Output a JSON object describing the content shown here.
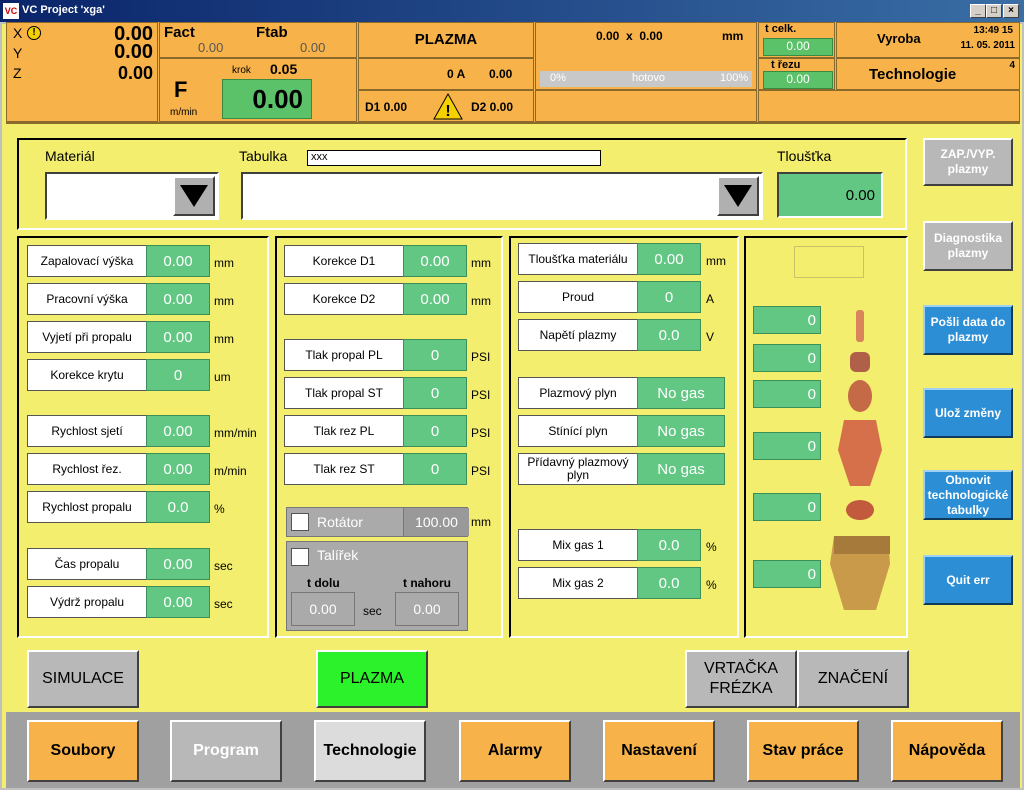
{
  "window": {
    "title": "VC Project 'xga'",
    "logo": "VC"
  },
  "header": {
    "x_label": "X",
    "y_label": "Y",
    "z_label": "Z",
    "x": "0.00",
    "y": "0.00",
    "z": "0.00",
    "fact_label": "Fact",
    "fact": "0.00",
    "ftab_label": "Ftab",
    "ftab": "0.00",
    "f_label": "F",
    "f_unit": "m/min",
    "krok_label": "krok",
    "krok": "0.05",
    "f_value": "0.00",
    "mode": "PLAZMA",
    "current": "0 A",
    "voltage": "0.00",
    "d1": "D1 0.00",
    "d2": "D2 0.00",
    "coords": "0.00  x  0.00",
    "coords_unit": "mm",
    "progress_start": "0%",
    "progress_label": "hotovo",
    "progress_end": "100%",
    "progress": 0,
    "t_celk_label": "t celk.",
    "t_celk": "0.00",
    "t_rezu_label": "t řezu",
    "t_rezu": "0.00",
    "vyroba": "Vyroba",
    "time": "13:49 15",
    "date": "11. 05. 2011",
    "technologie": "Technologie",
    "tech_num": "4"
  },
  "top": {
    "material_label": "Materiál",
    "material_value": "",
    "tabulka_label": "Tabulka",
    "tabulka_value": "xxx",
    "tabulka_select": "",
    "tloustka_label": "Tloušťka",
    "tloustka": "0.00"
  },
  "col1": [
    {
      "label": "Zapalovací výška",
      "value": "0.00",
      "unit": "mm"
    },
    {
      "label": "Pracovní výška",
      "value": "0.00",
      "unit": "mm"
    },
    {
      "label": "Vyjetí při propalu",
      "value": "0.00",
      "unit": "mm"
    },
    {
      "label": "Korekce krytu",
      "value": "0",
      "unit": "um"
    },
    {
      "label": "Rychlost sjetí",
      "value": "0.00",
      "unit": "mm/min"
    },
    {
      "label": "Rychlost řez.",
      "value": "0.00",
      "unit": "m/min"
    },
    {
      "label": "Rychlost propalu",
      "value": "0.0",
      "unit": "%"
    },
    {
      "label": "Čas propalu",
      "value": "0.00",
      "unit": "sec"
    },
    {
      "label": "Výdrž propalu",
      "value": "0.00",
      "unit": "sec"
    }
  ],
  "col2": [
    {
      "label": "Korekce D1",
      "value": "0.00",
      "unit": "mm"
    },
    {
      "label": "Korekce D2",
      "value": "0.00",
      "unit": "mm"
    },
    {
      "label": "Tlak propal PL",
      "value": "0",
      "unit": "PSI"
    },
    {
      "label": "Tlak propal ST",
      "value": "0",
      "unit": "PSI"
    },
    {
      "label": "Tlak rez PL",
      "value": "0",
      "unit": "PSI"
    },
    {
      "label": "Tlak rez ST",
      "value": "0",
      "unit": "PSI"
    }
  ],
  "rotator": {
    "label": "Rotátor",
    "value": "100.00",
    "unit": "mm"
  },
  "talirek": {
    "label": "Talířek",
    "t_dolu": "t dolu",
    "t_nahoru": "t nahoru",
    "dolu": "0.00",
    "nahoru": "0.00",
    "unit": "sec"
  },
  "col3": [
    {
      "label": "Tloušťka materiálu",
      "value": "0.00",
      "unit": "mm"
    },
    {
      "label": "Proud",
      "value": "0",
      "unit": "A"
    },
    {
      "label": "Napětí plazmy",
      "value": "0.0",
      "unit": "V"
    },
    {
      "label": "Plazmový plyn",
      "value": "No gas",
      "unit": ""
    },
    {
      "label": "Stínící plyn",
      "value": "No gas",
      "unit": ""
    },
    {
      "label": "Přídavný plazmový plyn",
      "value": "No gas",
      "unit": ""
    },
    {
      "label": "Mix gas 1",
      "value": "0.0",
      "unit": "%"
    },
    {
      "label": "Mix gas 2",
      "value": "0.0",
      "unit": "%"
    }
  ],
  "parts": [
    "0",
    "0",
    "0",
    "0",
    "0",
    "0"
  ],
  "side": [
    {
      "label": "ZAP./VYP. plazmy"
    },
    {
      "label": "Diagnostika plazmy"
    },
    {
      "label": "Pošli data do plazmy"
    },
    {
      "label": "Ulož změny"
    },
    {
      "label": "Obnovit technologické tabulky"
    },
    {
      "label": "Quit err"
    }
  ],
  "modes": {
    "simulace": "SIMULACE",
    "plazma": "PLAZMA",
    "vrtacka": "VRTAČKA FRÉZKA",
    "znaceni": "ZNAČENÍ"
  },
  "nav": [
    "Soubory",
    "Program",
    "Technologie",
    "Alarmy",
    "Nastavení",
    "Stav práce",
    "Nápověda"
  ],
  "colors": {
    "panel": "#f3ee6d",
    "header": "#f7b34a",
    "value": "#63c784",
    "active": "#2cf22c",
    "blue": "#2c8fd6"
  }
}
